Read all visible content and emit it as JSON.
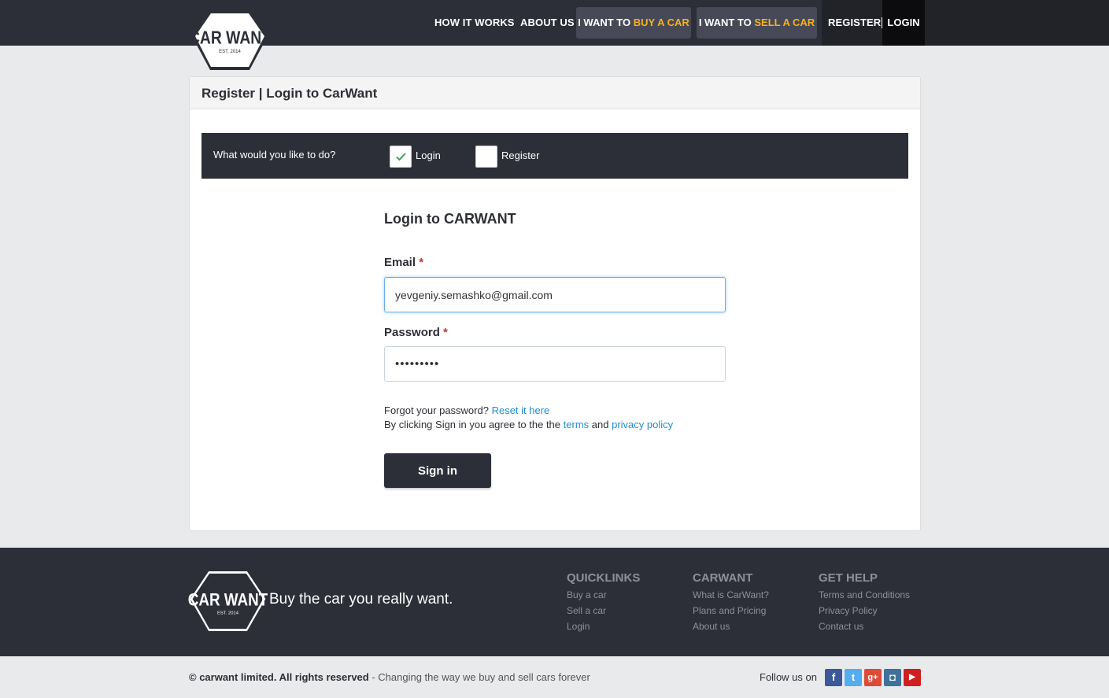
{
  "nav": {
    "how_it_works": "HOW IT WORKS",
    "about_us": "ABOUT US",
    "buy_prefix": "I WANT TO",
    "buy_highlight": "BUY A CAR",
    "sell_prefix": "I WANT TO",
    "sell_highlight": "SELL A CAR",
    "register": "REGISTER",
    "login": "LOGIN"
  },
  "logo": {
    "brand": "CAR WANT",
    "est": "EST. 2014"
  },
  "card": {
    "title": "Register | Login to CarWant",
    "question": "What would you like to do?",
    "options": [
      {
        "label": "Login",
        "checked": true
      },
      {
        "label": "Register",
        "checked": false
      }
    ]
  },
  "form": {
    "title": "Login to CARWANT",
    "email_label": "Email",
    "email_value": "yevgeniy.semashko@gmail.com",
    "password_label": "Password",
    "password_value": "•••••••••",
    "required_mark": "*",
    "forgot_text": "Forgot your password?",
    "reset_link": "Reset it here",
    "agree_text": "By clicking Sign in you agree to the the",
    "terms_link": "terms",
    "and_text": "and",
    "privacy_link": "privacy policy",
    "signin_label": "Sign in"
  },
  "footer": {
    "tagline": "Buy the car you really want.",
    "columns": [
      {
        "title": "QUICKLINKS",
        "links": [
          "Buy a car",
          "Sell a car",
          "Login"
        ]
      },
      {
        "title": "CARWANT",
        "links": [
          "What is CarWant?",
          "Plans and Pricing",
          "About us"
        ]
      },
      {
        "title": "GET HELP",
        "links": [
          "Terms and Conditions",
          "Privacy Policy",
          "Contact us"
        ]
      }
    ],
    "copyright_bold": "© carwant limited. All rights reserved",
    "copyright_rest": " - Changing the way we buy and sell cars forever",
    "follow_label": "Follow us on",
    "social": [
      {
        "icon": "facebook-icon",
        "glyph": "f",
        "color": "#3b5998"
      },
      {
        "icon": "twitter-icon",
        "glyph": "t",
        "color": "#55acee"
      },
      {
        "icon": "google-plus-icon",
        "glyph": "g+",
        "color": "#dd4b39"
      },
      {
        "icon": "instagram-icon",
        "glyph": "◘",
        "color": "#3f729b"
      },
      {
        "icon": "youtube-icon",
        "glyph": "▶",
        "color": "#cd201f"
      }
    ]
  },
  "colors": {
    "accent": "#f5b120",
    "dark": "#2d2f38",
    "link": "#1f8fd0"
  }
}
